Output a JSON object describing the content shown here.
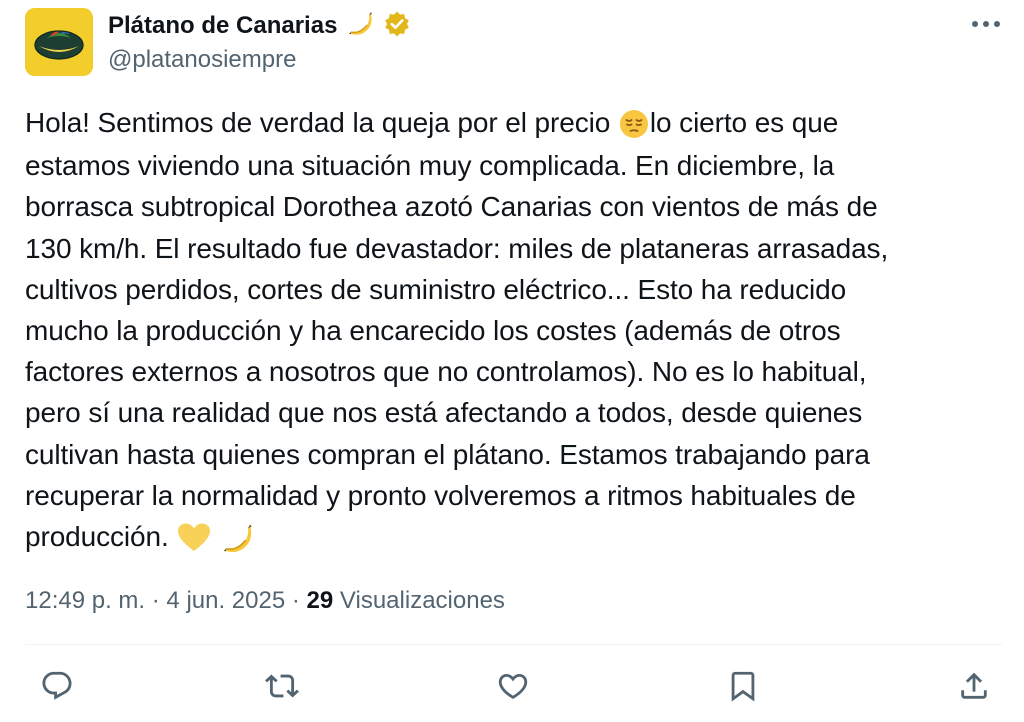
{
  "author": {
    "display_name": "Plátano de Canarias",
    "handle": "@platanosiempre",
    "verified_color": "#e2b719",
    "avatar_background": "#f2cd2c",
    "name_emoji": "banana-icon"
  },
  "tweet": {
    "lines": [
      "Hola! Sentimos de verdad la queja por el precio",
      "lo cierto es que",
      "estamos viviendo una situación muy complicada. En diciembre, la",
      "borrasca subtropical Dorothea azotó Canarias con vientos de más de",
      "130 km/h. El resultado fue devastador: miles de plataneras arrasadas,",
      "cultivos perdidos, cortes de suministro eléctrico... Esto ha reducido",
      "mucho la producción y ha encarecido los costes (además de otros",
      "factores externos a nosotros que no controlamos). No es lo habitual,",
      "pero sí una realidad que nos está afectando a todos, desde quienes",
      "cultivan hasta quienes compran el plátano. Estamos trabajando para",
      "recuperar la normalidad y pronto volveremos a ritmos habituales de",
      "producción."
    ],
    "emojis": [
      "pensive-face-icon",
      "yellow-heart-icon",
      "banana-icon"
    ]
  },
  "meta": {
    "time": "12:49 p. m.",
    "separator": "·",
    "date": "4 jun. 2025",
    "views_count": "29",
    "views_label": "Visualizaciones"
  },
  "actions": [
    "reply-icon",
    "retweet-icon",
    "like-icon",
    "bookmark-icon",
    "share-icon"
  ],
  "colors": {
    "text": "#0f1419",
    "secondary": "#536471",
    "divider": "#eff3f4"
  }
}
